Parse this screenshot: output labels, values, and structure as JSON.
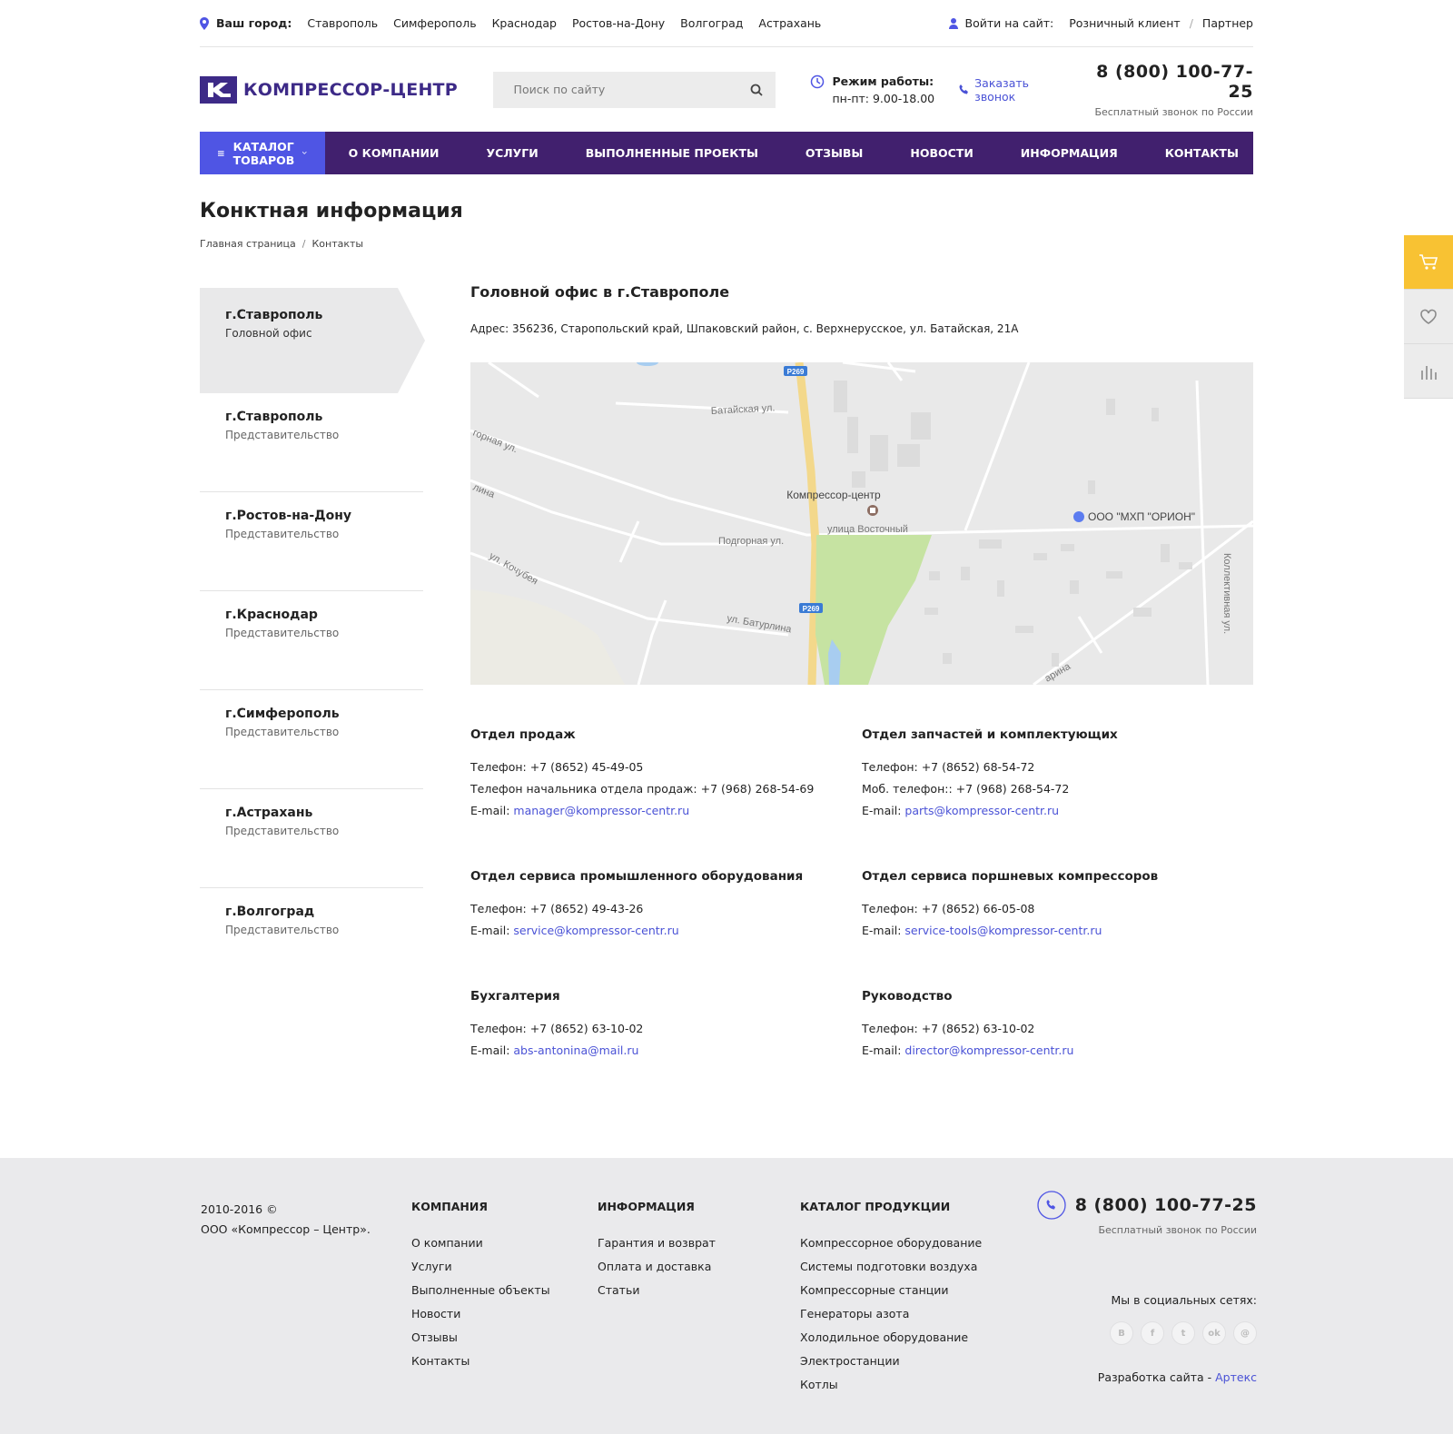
{
  "topbar": {
    "city_label": "Ваш город:",
    "cities": [
      "Ставрополь",
      "Симферополь",
      "Краснодар",
      "Ростов-на-Дону",
      "Волгоград",
      "Астрахань"
    ],
    "login_label": "Войти на сайт:",
    "login_retail": "Розничный клиент",
    "login_sep": "/",
    "login_partner": "Партнер"
  },
  "header": {
    "logo_text": "КОМПРЕССОР-ЦЕНТР",
    "search_placeholder": "Поиск по сайту",
    "hours_title": "Режим работы:",
    "hours_value": "пн-пт: 9.00-18.00",
    "callback": "Заказать звонок",
    "phone": "8 (800) 100-77-25",
    "phone_sub": "Бесплатный звонок по России"
  },
  "nav": {
    "catalog": "КАТАЛОГ ТОВАРОВ",
    "items": [
      "О КОМПАНИИ",
      "УСЛУГИ",
      "ВЫПОЛНЕННЫЕ ПРОЕКТЫ",
      "ОТЗЫВЫ",
      "НОВОСТИ",
      "ИНФОРМАЦИЯ",
      "КОНТАКТЫ"
    ]
  },
  "page": {
    "title": "Конктная информация",
    "breadcrumb": [
      "Главная страница",
      "Контакты"
    ],
    "breadcrumb_sep": "/"
  },
  "offices": [
    {
      "city": "г.Ставрополь",
      "type": "Головной офис"
    },
    {
      "city": "г.Ставрополь",
      "type": "Представительство"
    },
    {
      "city": "г.Ростов-на-Дону",
      "type": "Представительство"
    },
    {
      "city": "г.Краснодар",
      "type": "Представительство"
    },
    {
      "city": "г.Симферополь",
      "type": "Представительство"
    },
    {
      "city": "г.Астрахань",
      "type": "Представительство"
    },
    {
      "city": "г.Волгоград",
      "type": "Представительство"
    }
  ],
  "office": {
    "title": "Головной офис в г.Ставрополе",
    "address": "Адрес: 356236, Старопольский край, Шпаковский район, с. Верхнерусское, ул. Батайская, 21А"
  },
  "map": {
    "streets": [
      "Батайская ул.",
      "горная ул.",
      "лина",
      "ул. Кочубея",
      "Подгорная ул.",
      "улица Восточный",
      "ул. Батурлина",
      "Коллективная ул.",
      "арина"
    ],
    "road_badges": [
      "Р269",
      "Р269"
    ],
    "place_main": "Компрессор-центр",
    "place_other": "ООО \"МХП \"ОРИОН\""
  },
  "departments": [
    {
      "title": "Отдел продаж",
      "lines": [
        "Телефон: +7 (8652) 45-49-05",
        "Телефон начальника отдела продаж: +7 (968) 268-54-69"
      ],
      "email_label": "E-mail:",
      "email": "manager@kompressor-centr.ru"
    },
    {
      "title": "Отдел запчастей и комплектующих",
      "lines": [
        "Телефон: +7 (8652) 68-54-72",
        "Моб. телефон:: +7 (968) 268-54-72"
      ],
      "email_label": "E-mail:",
      "email": "parts@kompressor-centr.ru"
    },
    {
      "title": "Отдел сервиса промышленного оборудования",
      "lines": [
        "Телефон: +7 (8652) 49-43-26"
      ],
      "email_label": "E-mail:",
      "email": "service@kompressor-centr.ru"
    },
    {
      "title": "Отдел сервиса поршневых компрессоров",
      "lines": [
        "Телефон: +7 (8652) 66-05-08"
      ],
      "email_label": "E-mail:",
      "email": "service-tools@kompressor-centr.ru"
    },
    {
      "title": "Бухгалтерия",
      "lines": [
        "Телефон: +7 (8652) 63-10-02"
      ],
      "email_label": "E-mail:",
      "email": "abs-antonina@mail.ru"
    },
    {
      "title": "Руководство",
      "lines": [
        "Телефон: +7 (8652) 63-10-02"
      ],
      "email_label": "E-mail:",
      "email": "director@kompressor-centr.ru"
    }
  ],
  "footer": {
    "copyright": "2010-2016 ©",
    "company": "ООО «Компрессор – Центр».",
    "col_company_title": "КОМПАНИЯ",
    "col_company": [
      "О компании",
      "Услуги",
      "Выполненные объекты",
      "Новости",
      "Отзывы",
      "Контакты"
    ],
    "col_info_title": "ИНФОРМАЦИЯ",
    "col_info": [
      "Гарантия и возврат",
      "Оплата и доставка",
      "Статьи"
    ],
    "col_catalog_title": "КАТАЛОГ ПРОДУКЦИИ",
    "col_catalog": [
      "Компрессорное оборудование",
      "Системы подготовки воздуха",
      "Компрессорные станции",
      "Генераторы азота",
      "Холодильное оборудование",
      "Электростанции",
      "Котлы"
    ],
    "phone": "8 (800) 100-77-25",
    "phone_sub": "Бесплатный звонок по России",
    "social_label": "Мы в социальных сетях:",
    "socials": [
      "В",
      "f",
      "t",
      "ok",
      "@"
    ],
    "dev_label": "Разработка сайта -",
    "dev_link": "Артекс"
  },
  "colors": {
    "brand": "#3d2a87",
    "nav": "#41206e",
    "catalog": "#4f55e4",
    "link": "#4a52d6",
    "cart": "#f8c233"
  }
}
